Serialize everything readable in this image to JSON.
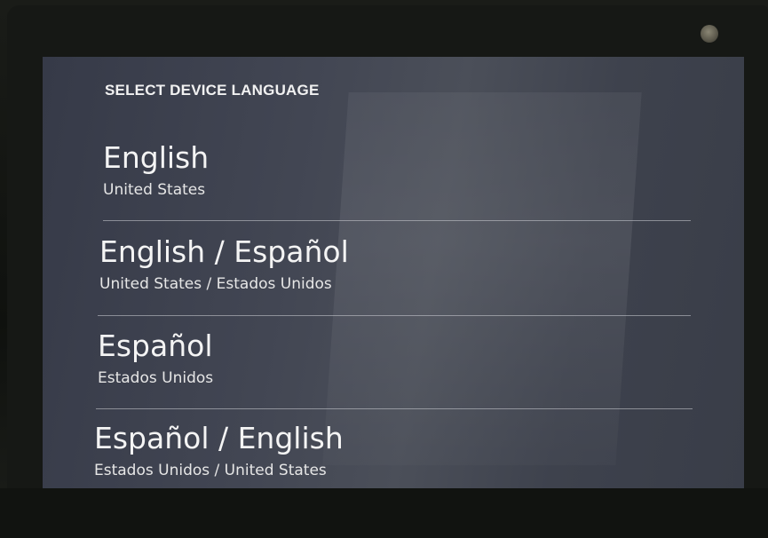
{
  "screen": {
    "heading": "SELECT DEVICE LANGUAGE"
  },
  "languages": [
    {
      "main": "English",
      "sub": "United States"
    },
    {
      "main": "English / Español",
      "sub": "United States / Estados Unidos"
    },
    {
      "main": "Español",
      "sub": "Estados Unidos"
    },
    {
      "main": "Español / English",
      "sub": "Estados Unidos / United States"
    }
  ],
  "colors": {
    "screen_background": "#424653",
    "text_primary": "#f4f4f4",
    "divider": "#cdd0d6",
    "bezel": "#161815"
  },
  "icons": {
    "camera": "camera-lens-icon"
  }
}
